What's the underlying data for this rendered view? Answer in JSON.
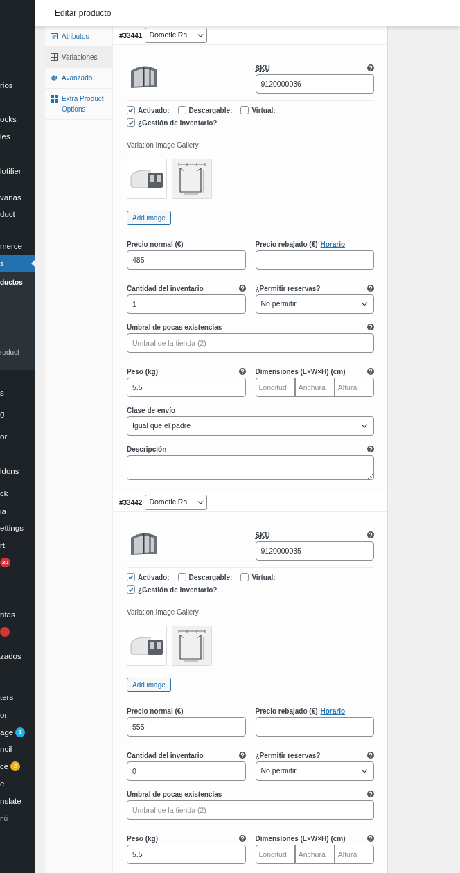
{
  "header": {
    "title": "Editar producto"
  },
  "sidebar": {
    "items": [
      {
        "label": "rios",
        "selected": false
      },
      {
        "label": "ocks",
        "selected": false
      },
      {
        "label": "les",
        "selected": false
      },
      {
        "label": "lotifier",
        "selected": false
      },
      {
        "label": "vanas",
        "selected": false
      },
      {
        "label": "duct",
        "selected": false
      },
      {
        "label": "merce",
        "selected": false
      },
      {
        "label": "s",
        "selected": true
      }
    ],
    "submenu": [
      {
        "label": "ductos",
        "selected": true
      },
      {
        "label": "roduct",
        "selected": false
      }
    ],
    "more_items": [
      {
        "label": "s",
        "selected": false
      },
      {
        "label": "g",
        "selected": false
      },
      {
        "label": "or",
        "selected": false
      },
      {
        "label": "ldons",
        "selected": false
      },
      {
        "label": "ck",
        "selected": false
      },
      {
        "label": "ia",
        "selected": false
      },
      {
        "label": "ettings",
        "selected": false
      },
      {
        "label": "rt",
        "selected": false
      },
      {
        "badge": {
          "text": "20",
          "color": "#d63638"
        },
        "selected": false
      },
      {
        "label": "ntas",
        "selected": false
      },
      {
        "badge": {
          "color": "#d63638"
        },
        "selected": false
      },
      {
        "label": "zados",
        "selected": false
      },
      {
        "label": "ters",
        "selected": false
      },
      {
        "label": "or",
        "selected": false
      },
      {
        "label": "age",
        "badge": {
          "text": "1",
          "color": "#1fb1e8"
        },
        "selected": false
      },
      {
        "label": "ncil",
        "selected": false
      },
      {
        "label": "ce",
        "badge": {
          "text": "2",
          "color": "#f0b01d"
        },
        "selected": false
      },
      {
        "label": "e",
        "selected": false
      },
      {
        "label": "nslate",
        "selected": false
      },
      {
        "label": "nú",
        "kind": "collapse",
        "selected": false
      }
    ]
  },
  "tabs": [
    {
      "label": "Atributos",
      "kind": "attributes",
      "selected": false
    },
    {
      "label": "Variaciones",
      "kind": "variations",
      "selected": true
    },
    {
      "label": "Avanzado",
      "kind": "advanced",
      "selected": false
    },
    {
      "label": "Extra Product Options",
      "kind": "extra",
      "selected": false
    }
  ],
  "variations": [
    {
      "id": "#33441",
      "attribute": "Dometic Ra",
      "sku": {
        "label": "SKU",
        "value": "9120000036",
        "help": true
      },
      "checkboxes": [
        {
          "label": "Activado:",
          "checked": true
        },
        {
          "label": "Descargable:",
          "checked": false
        },
        {
          "label": "Virtual:",
          "checked": false
        },
        {
          "label": "¿Gestión de inventario?",
          "checked": true
        }
      ],
      "gallery": {
        "label": "Variation Image Gallery",
        "images": [
          {
            "kind": "photo"
          },
          {
            "kind": "diagram"
          }
        ],
        "button": "Add image"
      },
      "regular_price": {
        "label": "Precio normal (€)",
        "value": "485",
        "help": false
      },
      "sale_price": {
        "label": "Precio rebajado (€)",
        "link": "Horario",
        "help": false
      },
      "stock": {
        "label": "Cantidad del inventario",
        "value": "1",
        "help": true
      },
      "backorders": {
        "label": "¿Permitir reservas?",
        "value": "No permitir",
        "help": true
      },
      "low_stock": {
        "label": "Umbral de pocas existencias",
        "placeholder": "Umbral de la tienda (2)",
        "help": true
      },
      "weight": {
        "label": "Peso (kg)",
        "value": "5.5",
        "help": true
      },
      "dimensions": {
        "label": "Dimensiones (L×W×H) (cm)",
        "placeholders": [
          "Longitud",
          "Anchura",
          "Altura"
        ],
        "help": true
      },
      "shipping": {
        "label": "Clase de envío",
        "value": "Igual que el padre",
        "help": false
      },
      "description": {
        "label": "Descripción",
        "help": true
      }
    },
    {
      "id": "#33442",
      "attribute": "Dometic Ra",
      "sku": {
        "label": "SKU",
        "value": "9120000035",
        "help": true
      },
      "checkboxes": [
        {
          "label": "Activado:",
          "checked": true
        },
        {
          "label": "Descargable:",
          "checked": false
        },
        {
          "label": "Virtual:",
          "checked": false
        },
        {
          "label": "¿Gestión de inventario?",
          "checked": true
        }
      ],
      "gallery": {
        "label": "Variation Image Gallery",
        "images": [
          {
            "kind": "photo"
          },
          {
            "kind": "diagram"
          }
        ],
        "button": "Add image"
      },
      "regular_price": {
        "label": "Precio normal (€)",
        "value": "555",
        "help": false
      },
      "sale_price": {
        "label": "Precio rebajado (€)",
        "link": "Horario",
        "help": false
      },
      "stock": {
        "label": "Cantidad del inventario",
        "value": "0",
        "help": true
      },
      "backorders": {
        "label": "¿Permitir reservas?",
        "value": "No permitir",
        "help": true
      },
      "low_stock": {
        "label": "Umbral de pocas existencias",
        "placeholder": "Umbral de la tienda (2)",
        "help": true
      },
      "weight": {
        "label": "Peso (kg)",
        "value": "5.5",
        "help": true
      },
      "dimensions": {
        "label": "Dimensiones (L×W×H) (cm)",
        "placeholders": [
          "Longitud",
          "Anchura",
          "Altura"
        ],
        "help": true
      }
    }
  ]
}
